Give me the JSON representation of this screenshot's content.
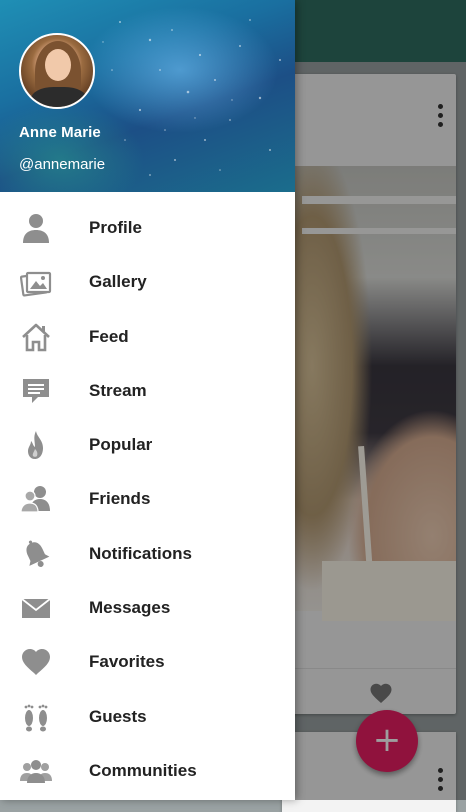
{
  "background": {
    "fab_label": "+",
    "colors": {
      "app_bar": "#2f6f62",
      "fab": "#e91e63"
    }
  },
  "drawer": {
    "user": {
      "name": "Anne Marie",
      "handle": "@annemarie"
    },
    "items": [
      {
        "label": "Profile",
        "icon": "person-icon"
      },
      {
        "label": "Gallery",
        "icon": "gallery-icon"
      },
      {
        "label": "Feed",
        "icon": "home-icon"
      },
      {
        "label": "Stream",
        "icon": "chat-icon"
      },
      {
        "label": "Popular",
        "icon": "flame-icon"
      },
      {
        "label": "Friends",
        "icon": "friends-icon"
      },
      {
        "label": "Notifications",
        "icon": "bell-icon"
      },
      {
        "label": "Messages",
        "icon": "envelope-icon"
      },
      {
        "label": "Favorites",
        "icon": "heart-icon"
      },
      {
        "label": "Guests",
        "icon": "footprints-icon"
      },
      {
        "label": "Communities",
        "icon": "group-icon"
      }
    ],
    "colors": {
      "icon": "#8e8e8e",
      "label": "#222222"
    }
  }
}
